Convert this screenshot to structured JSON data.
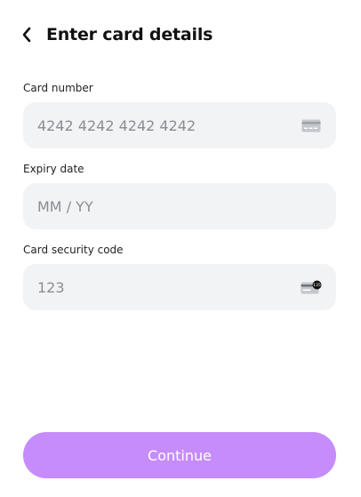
{
  "header": {
    "title": "Enter card details",
    "back_icon": "chevron-left-icon"
  },
  "fields": {
    "card_number": {
      "label": "Card number",
      "placeholder": "4242 4242 4242 4242",
      "value": "",
      "icon": "credit-card-icon"
    },
    "expiry": {
      "label": "Expiry date",
      "placeholder": "MM / YY",
      "value": ""
    },
    "cvc": {
      "label": "Card security code",
      "placeholder": "123",
      "value": "",
      "icon": "card-cvc-icon",
      "icon_badge": "135"
    }
  },
  "actions": {
    "continue_label": "Continue"
  },
  "colors": {
    "accent": "#c68cfb",
    "field_bg": "#f2f3f5",
    "placeholder": "#8a8d93"
  }
}
